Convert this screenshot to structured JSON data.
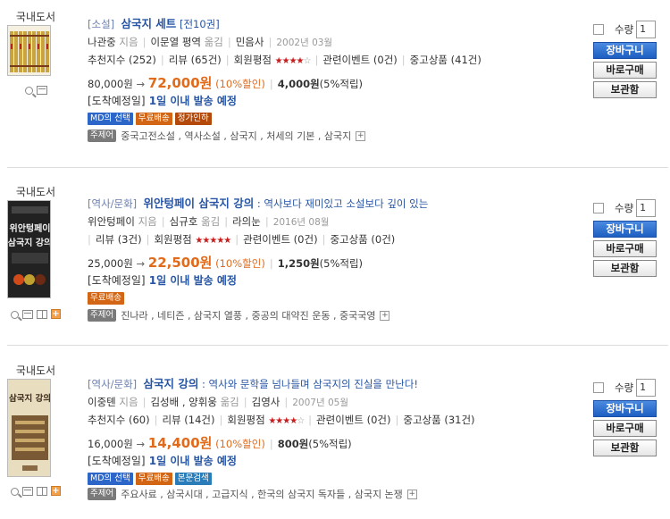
{
  "items": [
    {
      "category": "국내도서",
      "cate": "[소설]",
      "name": "삼국지 세트",
      "vol": "[전10권]",
      "subtitle": "",
      "author": "나관중",
      "author_role": "지음",
      "translator": "이문열 평역",
      "translator_role": "옮김",
      "publisher": "민음사",
      "date": "2002년 03월",
      "recommend": "추천지수 (252)",
      "review": "리뷰 (65건)",
      "rating_label": "회원평점",
      "stars_on": "★★★★",
      "stars_off": "☆",
      "events": "관련이벤트 (0건)",
      "used": "중고상품 (41건)",
      "orig_price": "80,000원",
      "arrow": "→",
      "sale_price": "72,000원",
      "rate": "(10%할인)",
      "point": "4,000원",
      "point_rate": "(5%적립)",
      "ship_label": "[도착예정일]",
      "ship": "1일 이내 발송 예정",
      "badges": [
        "MD의 선택",
        "무료배송",
        "정가인하"
      ],
      "tag_key": "주제어",
      "tags": "중국고전소설 , 역사소설 , 삼국지 , 처세의 기본 , 삼국지",
      "qty_label": "수량",
      "qty": "1",
      "btn_cart": "장바구니",
      "btn_buy": "바로구매",
      "btn_keep": "보관함"
    },
    {
      "category": "국내도서",
      "cate": "[역사/문화]",
      "name": "위안텅페이 삼국지 강의",
      "vol": "",
      "subtitle": " : 역사보다 재미있고 소설보다 깊이 있는",
      "author": "위안텅페이",
      "author_role": "지음",
      "translator": "심규호",
      "translator_role": "옮김",
      "publisher": "라의눈",
      "date": "2016년 08월",
      "recommend": "",
      "review": "리뷰 (3건)",
      "rating_label": "회원평점",
      "stars_on": "★★★★★",
      "stars_off": "",
      "events": "관련이벤트 (0건)",
      "used": "중고상품 (0건)",
      "orig_price": "25,000원",
      "arrow": "→",
      "sale_price": "22,500원",
      "rate": "(10%할인)",
      "point": "1,250원",
      "point_rate": "(5%적립)",
      "ship_label": "[도착예정일]",
      "ship": "1일 이내 발송 예정",
      "badges": [
        "무료배송"
      ],
      "tag_key": "주제어",
      "tags": "진나라 , 네티즌 , 삼국지 열풍 , 중공의 대약진 운동 , 중국국영",
      "qty_label": "수량",
      "qty": "1",
      "btn_cart": "장바구니",
      "btn_buy": "바로구매",
      "btn_keep": "보관함"
    },
    {
      "category": "국내도서",
      "cate": "[역사/문화]",
      "name": "삼국지 강의",
      "vol": "",
      "subtitle": " : 역사와 문학을 넘나들며 삼국지의 진실을 만난다!",
      "author": "이중톈",
      "author_role": "지음",
      "translator": "김성배 , 양휘웅",
      "translator_role": "옮김",
      "publisher": "김영사",
      "date": "2007년 05월",
      "recommend": "추천지수 (60)",
      "review": "리뷰 (14건)",
      "rating_label": "회원평점",
      "stars_on": "★★★★",
      "stars_off": "☆",
      "events": "관련이벤트 (0건)",
      "used": "중고상품 (31건)",
      "orig_price": "16,000원",
      "arrow": "→",
      "sale_price": "14,400원",
      "rate": "(10%할인)",
      "point": "800원",
      "point_rate": "(5%적립)",
      "ship_label": "[도착예정일]",
      "ship": "1일 이내 발송 예정",
      "badges": [
        "MD의 선택",
        "무료배송",
        "본문검색"
      ],
      "tag_key": "주제어",
      "tags": "주요사료 , 삼국시대 , 고급지식 , 한국의 삼국지 독자들 , 삼국지 논쟁",
      "qty_label": "수량",
      "qty": "1",
      "btn_cart": "장바구니",
      "btn_buy": "바로구매",
      "btn_keep": "보관함"
    }
  ],
  "cover2_text": "위안텅페이 삼국지강의",
  "cover3_text": "삼국지 강의"
}
